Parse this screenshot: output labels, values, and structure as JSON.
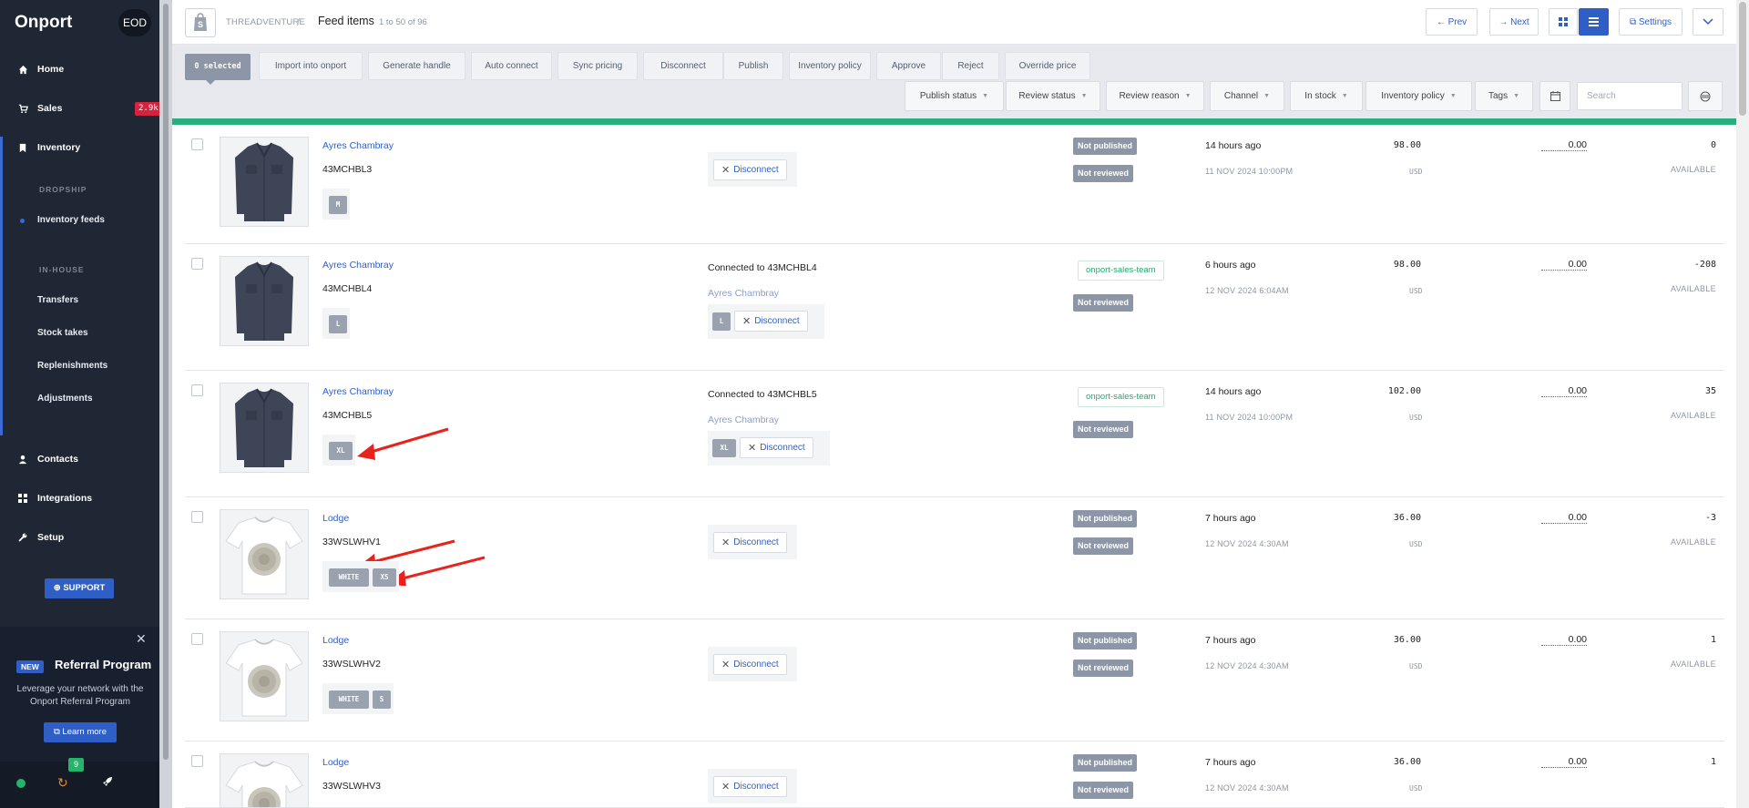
{
  "sidebar": {
    "logo": "Onport",
    "workspace": "EOD",
    "items": [
      {
        "label": "Home",
        "icon": "home-icon"
      },
      {
        "label": "Sales",
        "icon": "cart-icon",
        "badge": "2.9k"
      },
      {
        "label": "Inventory",
        "icon": "bookmark-icon"
      }
    ],
    "inventory_sections": {
      "dropship_heading": "DROPSHIP",
      "dropship_items": [
        "Inventory feeds"
      ],
      "inhouse_heading": "IN-HOUSE",
      "inhouse_items": [
        "Transfers",
        "Stock takes",
        "Replenishments",
        "Adjustments"
      ]
    },
    "bottom_items": [
      {
        "label": "Contacts",
        "icon": "user-icon"
      },
      {
        "label": "Integrations",
        "icon": "grid-icon"
      },
      {
        "label": "Setup",
        "icon": "wrench-icon"
      }
    ],
    "support_label": "SUPPORT",
    "referral": {
      "new_badge": "NEW",
      "title": "Referral Program",
      "description": "Leverage your network with the Onport Referral Program",
      "button": "Learn more"
    },
    "footer": {
      "notification_count": "9"
    }
  },
  "header": {
    "store": "THREADVENTURE",
    "separator": "/",
    "title": "Feed items",
    "count": "1 to 50 of 96",
    "prev": "Prev",
    "next": "Next",
    "settings": "Settings"
  },
  "toolbar": {
    "selected": "0 selected",
    "actions": [
      "Import into onport",
      "Generate handle",
      "Auto connect",
      "Sync pricing",
      "Disconnect",
      "Publish",
      "Inventory policy",
      "Approve",
      "Reject",
      "Override price"
    ],
    "filters": [
      "Publish status",
      "Review status",
      "Review reason",
      "Channel",
      "In stock",
      "Inventory policy",
      "Tags"
    ],
    "search_placeholder": "Search"
  },
  "rows": [
    {
      "name": "Ayres Chambray",
      "sku": "43MCHBL3",
      "options": [
        "M"
      ],
      "connected_text": "",
      "connected_name": "",
      "connected_options": [],
      "disconnect": "Disconnect",
      "status1": "Not published",
      "status1_type": "gray",
      "status2": "Not reviewed",
      "ago": "14 hours ago",
      "date": "11 NOV 2024 10:00PM",
      "price": "98.00",
      "currency": "USD",
      "cost": "0.00",
      "qty": "0",
      "availability": "AVAILABLE"
    },
    {
      "name": "Ayres Chambray",
      "sku": "43MCHBL4",
      "options": [
        "L"
      ],
      "connected_text": "Connected to 43MCHBL4",
      "connected_name": "Ayres Chambray",
      "connected_options": [
        "L"
      ],
      "disconnect": "Disconnect",
      "status1": "onport-sales-team",
      "status1_type": "green",
      "status2": "Not reviewed",
      "ago": "6 hours ago",
      "date": "12 NOV 2024 6:04AM",
      "price": "98.00",
      "currency": "USD",
      "cost": "0.00",
      "qty": "-208",
      "availability": "AVAILABLE"
    },
    {
      "name": "Ayres Chambray",
      "sku": "43MCHBL5",
      "options": [
        "XL"
      ],
      "connected_text": "Connected to 43MCHBL5",
      "connected_name": "Ayres Chambray",
      "connected_options": [
        "XL"
      ],
      "disconnect": "Disconnect",
      "status1": "onport-sales-team",
      "status1_type": "green",
      "status2": "Not reviewed",
      "ago": "14 hours ago",
      "date": "11 NOV 2024 10:00PM",
      "price": "102.00",
      "currency": "USD",
      "cost": "0.00",
      "qty": "35",
      "availability": "AVAILABLE"
    },
    {
      "name": "Lodge",
      "sku": "33WSLWHV1",
      "options": [
        "WHITE",
        "XS"
      ],
      "connected_text": "",
      "connected_name": "",
      "connected_options": [],
      "disconnect": "Disconnect",
      "status1": "Not published",
      "status1_type": "gray",
      "status2": "Not reviewed",
      "ago": "7 hours ago",
      "date": "12 NOV 2024 4:30AM",
      "price": "36.00",
      "currency": "USD",
      "cost": "0.00",
      "qty": "-3",
      "availability": "AVAILABLE"
    },
    {
      "name": "Lodge",
      "sku": "33WSLWHV2",
      "options": [
        "WHITE",
        "S"
      ],
      "connected_text": "",
      "connected_name": "",
      "connected_options": [],
      "disconnect": "Disconnect",
      "status1": "Not published",
      "status1_type": "gray",
      "status2": "Not reviewed",
      "ago": "7 hours ago",
      "date": "12 NOV 2024 4:30AM",
      "price": "36.00",
      "currency": "USD",
      "cost": "0.00",
      "qty": "1",
      "availability": "AVAILABLE"
    },
    {
      "name": "Lodge",
      "sku": "33WSLWHV3",
      "options": [],
      "connected_text": "",
      "connected_name": "",
      "connected_options": [],
      "disconnect": "Disconnect",
      "status1": "Not published",
      "status1_type": "gray",
      "status2": "Not reviewed",
      "ago": "7 hours ago",
      "date": "12 NOV 2024 4:30AM",
      "price": "36.00",
      "currency": "USD",
      "cost": "0.00",
      "qty": "1",
      "availability": ""
    }
  ],
  "colors": {
    "sidebar_bg": "#1f2735",
    "accent": "#2f5fc6",
    "sales_badge": "#d3233f",
    "progress_bar": "#26b07e",
    "annotation_arrow": "#e8231c"
  }
}
